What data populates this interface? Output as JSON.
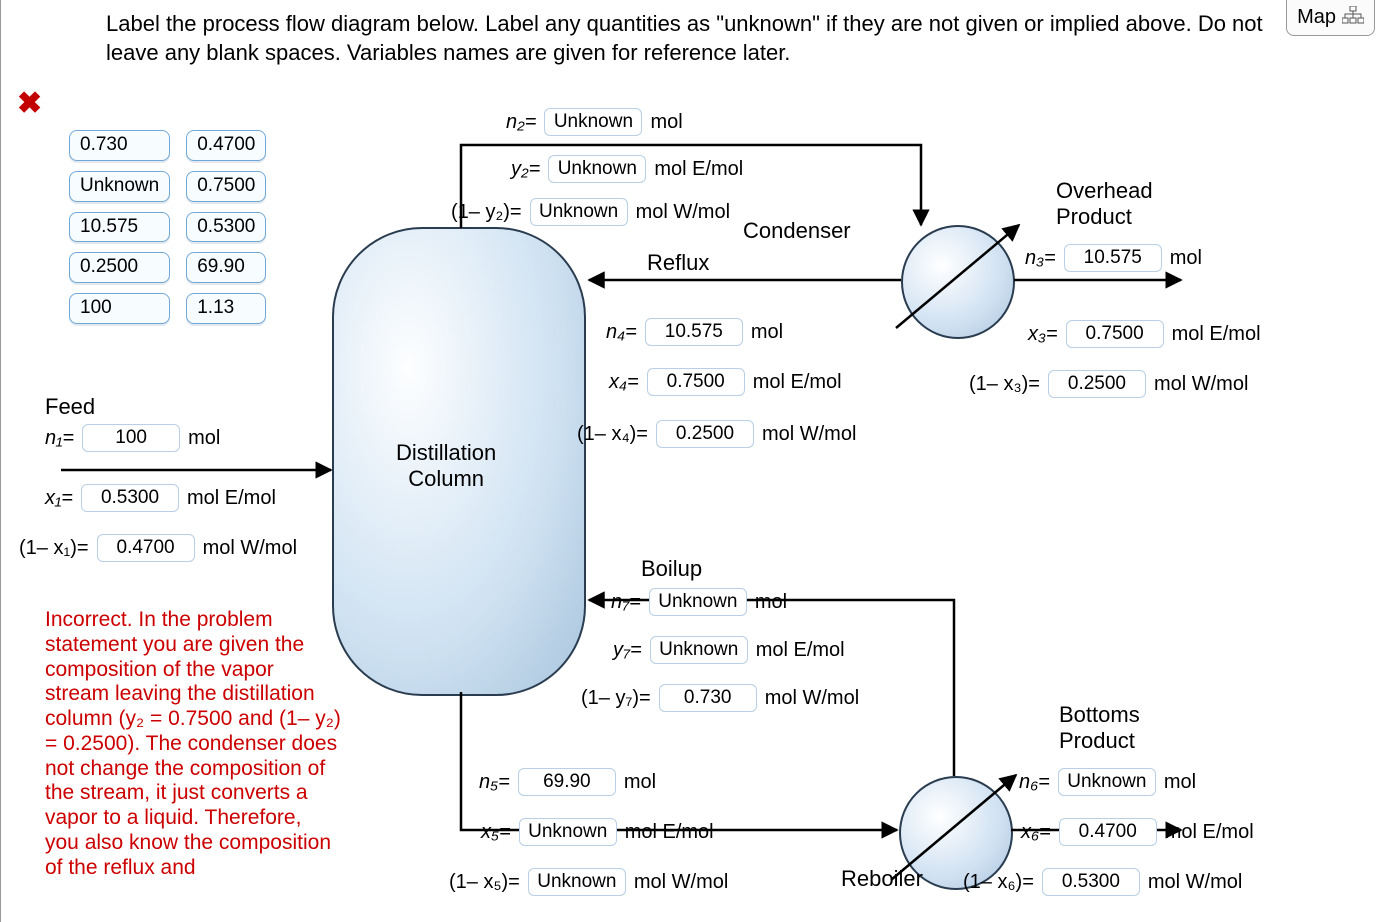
{
  "instruction": "Label the process flow diagram below. Label any quantities as \"unknown\" if they are not given or implied above. Do not leave any blank spaces. Variables names are given for reference later.",
  "map_label": "Map",
  "labels": {
    "feed": "Feed",
    "reflux": "Reflux",
    "condenser": "Condenser",
    "overhead_product": "Overhead\nProduct",
    "boilup": "Boilup",
    "reboiler": "Reboiler",
    "bottoms_product": "Bottoms\nProduct",
    "distillation_column": "Distillation\nColumn"
  },
  "chips": [
    "0.730",
    "0.4700",
    "Unknown",
    "0.7500",
    "10.575",
    "0.5300",
    "0.2500",
    "69.90",
    "100",
    "1.13"
  ],
  "units": {
    "mol": "mol",
    "molEmol": "mol E/mol",
    "molWmol": "mol W/mol"
  },
  "vars": {
    "n1": {
      "label": "n₁=",
      "value": "100"
    },
    "x1": {
      "label": "x₁=",
      "value": "0.5300"
    },
    "mx1": {
      "label": "(1– x₁)=",
      "value": "0.4700"
    },
    "n2": {
      "label": "n₂=",
      "value": "Unknown"
    },
    "y2": {
      "label": "y₂=",
      "value": "Unknown"
    },
    "my2": {
      "label": "(1– y₂)=",
      "value": "Unknown"
    },
    "n3": {
      "label": "n₃=",
      "value": "10.575"
    },
    "x3": {
      "label": "x₃=",
      "value": "0.7500"
    },
    "mx3": {
      "label": "(1– x₃)=",
      "value": "0.2500"
    },
    "n4": {
      "label": "n₄=",
      "value": "10.575"
    },
    "x4": {
      "label": "x₄=",
      "value": "0.7500"
    },
    "mx4": {
      "label": "(1– x₄)=",
      "value": "0.2500"
    },
    "n5": {
      "label": "n₅=",
      "value": "69.90"
    },
    "x5": {
      "label": "x₅=",
      "value": "Unknown"
    },
    "mx5": {
      "label": "(1– x₅)=",
      "value": "Unknown"
    },
    "n6": {
      "label": "n₆=",
      "value": "Unknown"
    },
    "x6": {
      "label": "x₆=",
      "value": "0.4700"
    },
    "mx6": {
      "label": "(1– x₆)=",
      "value": "0.5300"
    },
    "n7": {
      "label": "n₇=",
      "value": "Unknown"
    },
    "y7": {
      "label": "y₇=",
      "value": "Unknown"
    },
    "my7": {
      "label": "(1– y₇)=",
      "value": "0.730"
    }
  },
  "feedback": "Incorrect. In the problem statement you are given the composition of the vapor stream leaving the distillation column (y₂ = 0.7500 and (1– y₂) = 0.2500). The condenser does not change the composition of the stream, it just converts a vapor to a liquid. Therefore, you also know the composition of the reflux and"
}
